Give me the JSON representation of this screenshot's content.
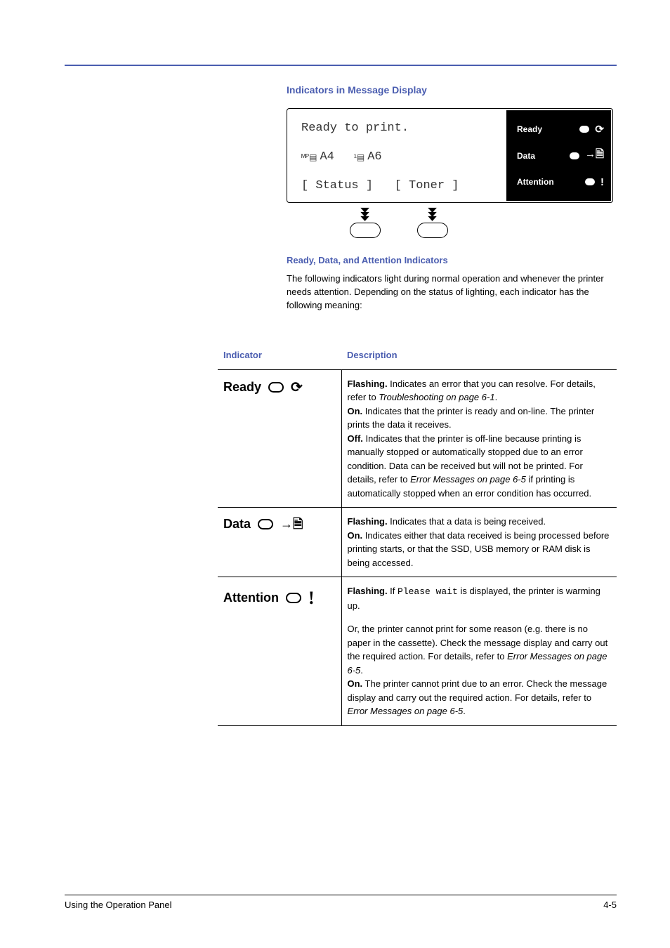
{
  "headings": {
    "section": "Indicators in Message Display",
    "subsection": "Ready, Data, and Attention Indicators"
  },
  "display": {
    "line1": "Ready to print.",
    "tray_mp": "A4",
    "tray_1": "A6",
    "status_btn": "[ Status ]",
    "toner_btn": "[ Toner  ]",
    "leds": {
      "ready": "Ready",
      "data": "Data",
      "attention": "Attention"
    }
  },
  "intro_para": "The following indicators light during normal operation and whenever the printer needs attention. Depending on the status of lighting, each indicator has the following meaning:",
  "table": {
    "col_indicator": "Indicator",
    "col_description": "Description",
    "rows": [
      {
        "name": "Ready",
        "descr": {
          "flashing_label": "Flashing.",
          "flashing_text_a": " Indicates an error that you can resolve. For details, refer to ",
          "flashing_link": "Troubleshooting on page 6-1",
          "flashing_text_b": ".",
          "on_label": "On.",
          "on_text": " Indicates that the printer is ready and on-line. The printer prints the data it receives.",
          "off_label": "Off.",
          "off_text_a": " Indicates that the printer is off-line because printing is manually stopped or automatically stopped due to an error condition. Data can be received but will not be printed. For details, refer to ",
          "off_link": "Error Messages on page 6-5",
          "off_text_b": " if printing is automatically stopped when an error condition has occurred."
        }
      },
      {
        "name": "Data",
        "descr": {
          "flashing_label": "Flashing.",
          "flashing_text": " Indicates that a data is being received.",
          "on_label": "On.",
          "on_text": " Indicates either that data received is being processed before printing starts, or that the SSD, USB memory or RAM disk is being accessed."
        }
      },
      {
        "name": "Attention",
        "descr": {
          "flashing_label": "Flashing.",
          "flashing_text_a": " If ",
          "flashing_code": "Please wait",
          "flashing_text_b": " is displayed, the printer is warming up.",
          "or_text_a": "Or, the printer cannot print for some reason (e.g. there is no paper in the cassette). Check the message display and carry out the required action. For details, refer to ",
          "or_link": "Error Messages on page 6-5",
          "or_text_b": ".",
          "on_label": "On.",
          "on_text_a": " The printer cannot print due to an error. Check the message display and carry out the required action. For details, refer to ",
          "on_link": "Error Messages on page 6-5",
          "on_text_b": "."
        }
      }
    ]
  },
  "footer": {
    "left": "Using the Operation Panel",
    "right": "4-5"
  }
}
